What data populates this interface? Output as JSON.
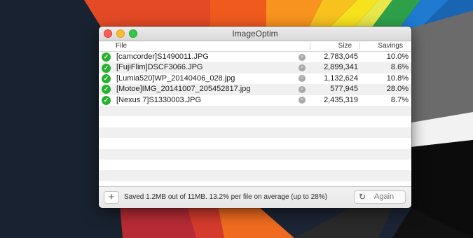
{
  "window": {
    "title": "ImageOptim"
  },
  "columns": {
    "file": "File",
    "size": "Size",
    "savings": "Savings"
  },
  "rows": [
    {
      "file": "[camcorder]S1490011.JPG",
      "size": "2,783,045",
      "savings": "10.0%"
    },
    {
      "file": "[FujiFlim]DSCF3066.JPG",
      "size": "2,899,341",
      "savings": "8.6%"
    },
    {
      "file": "[Lumia520]WP_20140406_028.jpg",
      "size": "1,132,624",
      "savings": "10.8%"
    },
    {
      "file": "[Motoe]IMG_20141007_205452817.jpg",
      "size": "577,945",
      "savings": "28.0%"
    },
    {
      "file": "[Nexus 7]S1330003.JPG",
      "size": "2,435,319",
      "savings": "8.7%"
    }
  ],
  "footer": {
    "add_label": "+",
    "status": "Saved 1.2MB out of 11MB. 13.2% per file on average (up to 28%)",
    "again_label": "Again"
  },
  "icons": {
    "row_status": "checkmark-icon",
    "row_preview": "magnifier-icon",
    "again": "refresh-icon"
  },
  "colors": {
    "status_ok": "#27b12f",
    "close": "#fc5f57",
    "minimize": "#fdbc2e",
    "zoom": "#34c748"
  }
}
